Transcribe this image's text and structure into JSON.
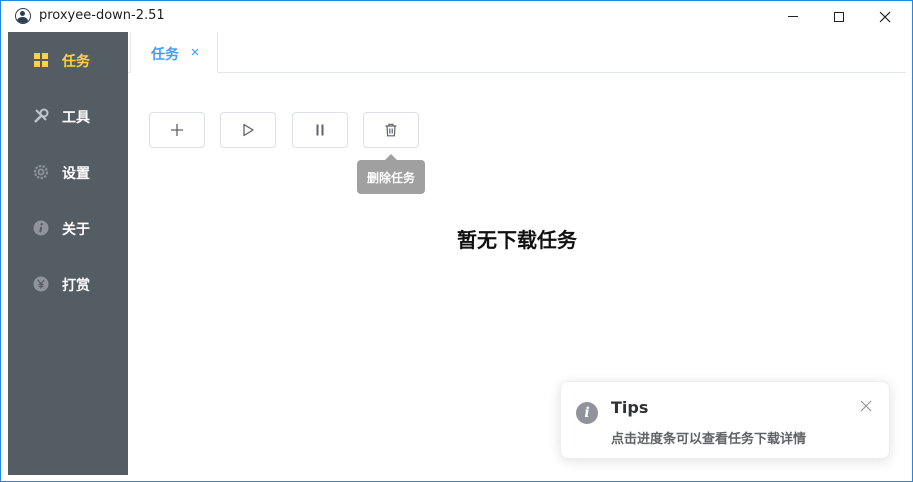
{
  "window": {
    "title": "proxyee-down-2.51",
    "controls": {
      "minimize": "minimize",
      "maximize": "maximize",
      "close": "close"
    }
  },
  "sidebar": {
    "background": "#545c64",
    "active_color": "#ffd04b",
    "items": [
      {
        "label": "任务",
        "icon": "grid-icon",
        "active": true
      },
      {
        "label": "工具",
        "icon": "tools-icon",
        "active": false
      },
      {
        "label": "设置",
        "icon": "gear-icon",
        "active": false
      },
      {
        "label": "关于",
        "icon": "info-icon",
        "active": false
      },
      {
        "label": "打赏",
        "icon": "yen-icon",
        "active": false
      }
    ]
  },
  "tabs": [
    {
      "label": "任务",
      "closable": true
    }
  ],
  "toolbar": {
    "buttons": [
      {
        "icon": "plus-icon"
      },
      {
        "icon": "play-icon"
      },
      {
        "icon": "pause-icon"
      },
      {
        "icon": "trash-icon"
      }
    ],
    "tooltip": "删除任务"
  },
  "main": {
    "empty_text": "暂无下载任务"
  },
  "notification": {
    "title": "Tips",
    "message": "点击进度条可以查看任务下载详情",
    "icon": "info-icon"
  },
  "colors": {
    "accent": "#409eff",
    "window_border": "#1e89e8"
  }
}
